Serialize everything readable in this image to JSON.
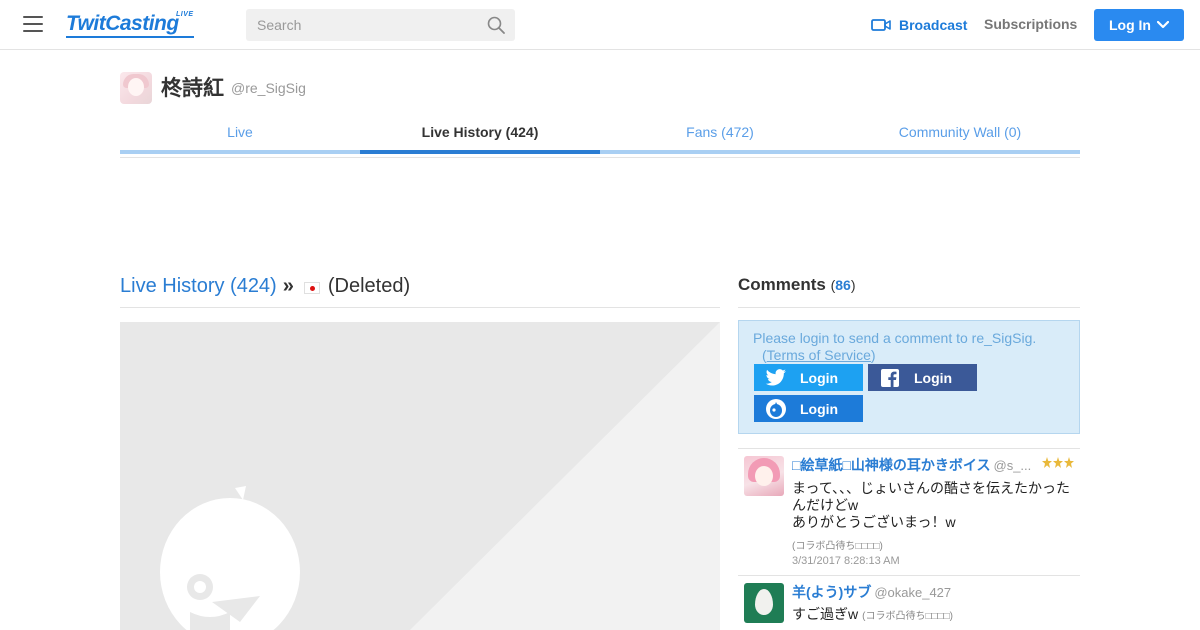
{
  "header": {
    "logo": "TwitCasting",
    "logo_tag": "LIVE",
    "search_placeholder": "Search",
    "broadcast_label": "Broadcast",
    "subscriptions_label": "Subscriptions",
    "login_label": "Log In"
  },
  "profile": {
    "name": "柊詩紅",
    "handle": "@re_SigSig"
  },
  "tabs": [
    {
      "label": "Live",
      "active": false
    },
    {
      "label": "Live History (424)",
      "active": true
    },
    {
      "label": "Fans (472)",
      "active": false
    },
    {
      "label": "Community Wall (0)",
      "active": false
    }
  ],
  "movie": {
    "history_link": "Live History (424)",
    "separator": "»",
    "title": "(Deleted)"
  },
  "comments": {
    "title": "Comments",
    "count_open": "(",
    "count": "86",
    "count_close": ")",
    "login_message": "Please login to send a comment to re_SigSig.",
    "tos_open": "(",
    "tos_link": "Terms of Service",
    "tos_close": ")",
    "twitter_login": "Login",
    "facebook_login": "Login",
    "twitcasting_login": "Login",
    "items": [
      {
        "name": "□絵草紙□山神様の耳かきボイス",
        "handle": "@s_...",
        "text_line1": "まって、、、じょいさんの酷さを伝えたかったんだけどw",
        "text_line2": "ありがとうございまっ！w",
        "sub": "(コラボ凸待ち□□□□)",
        "time": "3/31/2017 8:28:13 AM"
      },
      {
        "name": "羊(よう)サブ",
        "handle": "@okake_427",
        "text_line1": "すご過ぎw",
        "sub": "(コラボ凸待ち□□□□)"
      }
    ]
  },
  "colors": {
    "brand_blue": "#2a7dd3",
    "twitter": "#1da1f2",
    "facebook": "#3b5998"
  }
}
